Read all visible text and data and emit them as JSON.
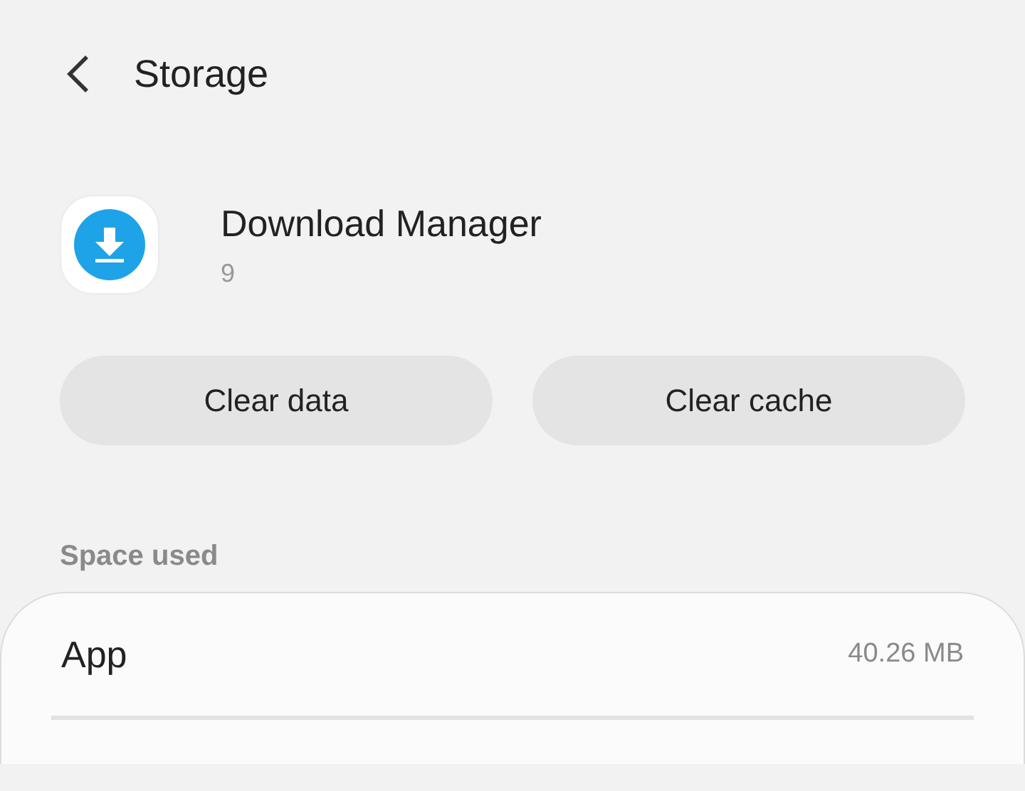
{
  "header": {
    "title": "Storage"
  },
  "app": {
    "name": "Download Manager",
    "version": "9"
  },
  "buttons": [
    "Clear data",
    "Clear cache"
  ],
  "section": {
    "title": "Space used"
  },
  "rows": [
    {
      "label": "App",
      "value": "40.26 MB"
    }
  ]
}
